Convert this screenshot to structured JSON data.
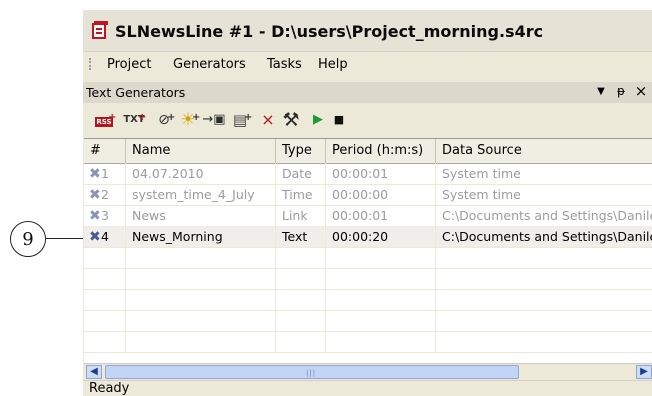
{
  "callout": {
    "number": "9"
  },
  "window": {
    "title": "SLNewsLine #1 - D:\\users\\Project_morning.s4rc"
  },
  "menu": [
    "Project",
    "Generators",
    "Tasks",
    "Help"
  ],
  "panel": {
    "title": "Text Generators",
    "buttons": {
      "dropdown": "▼",
      "pin": "ᵽ",
      "close": "×"
    }
  },
  "toolbar": {
    "new_rss": "RSS",
    "new_txt": "TXT",
    "icons": [
      "add-rss-icon",
      "add-txt-icon",
      "add-time-icon",
      "add-date-icon",
      "import-icon",
      "add-doc-icon",
      "delete-icon",
      "settings-tools-icon",
      "play-icon",
      "stop-icon"
    ]
  },
  "table": {
    "columns": [
      "#",
      "Name",
      "Type",
      "Period (h:m:s)",
      "Data Source"
    ],
    "rows": [
      {
        "num": "1",
        "name": "04.07.2010",
        "type": "Date",
        "period": "00:00:01",
        "source": "System time",
        "enabled": false
      },
      {
        "num": "2",
        "name": "system_time_4_July",
        "type": "Time",
        "period": "00:00:00",
        "source": "System time",
        "enabled": false
      },
      {
        "num": "3",
        "name": "News",
        "type": "Link",
        "period": "00:00:01",
        "source": "C:\\Documents and Settings\\Danile",
        "enabled": false
      },
      {
        "num": "4",
        "name": "News_Morning",
        "type": "Text",
        "period": "00:00:20",
        "source": "C:\\Documents and Settings\\Danile",
        "enabled": true
      }
    ]
  },
  "status": {
    "text": "Ready"
  }
}
